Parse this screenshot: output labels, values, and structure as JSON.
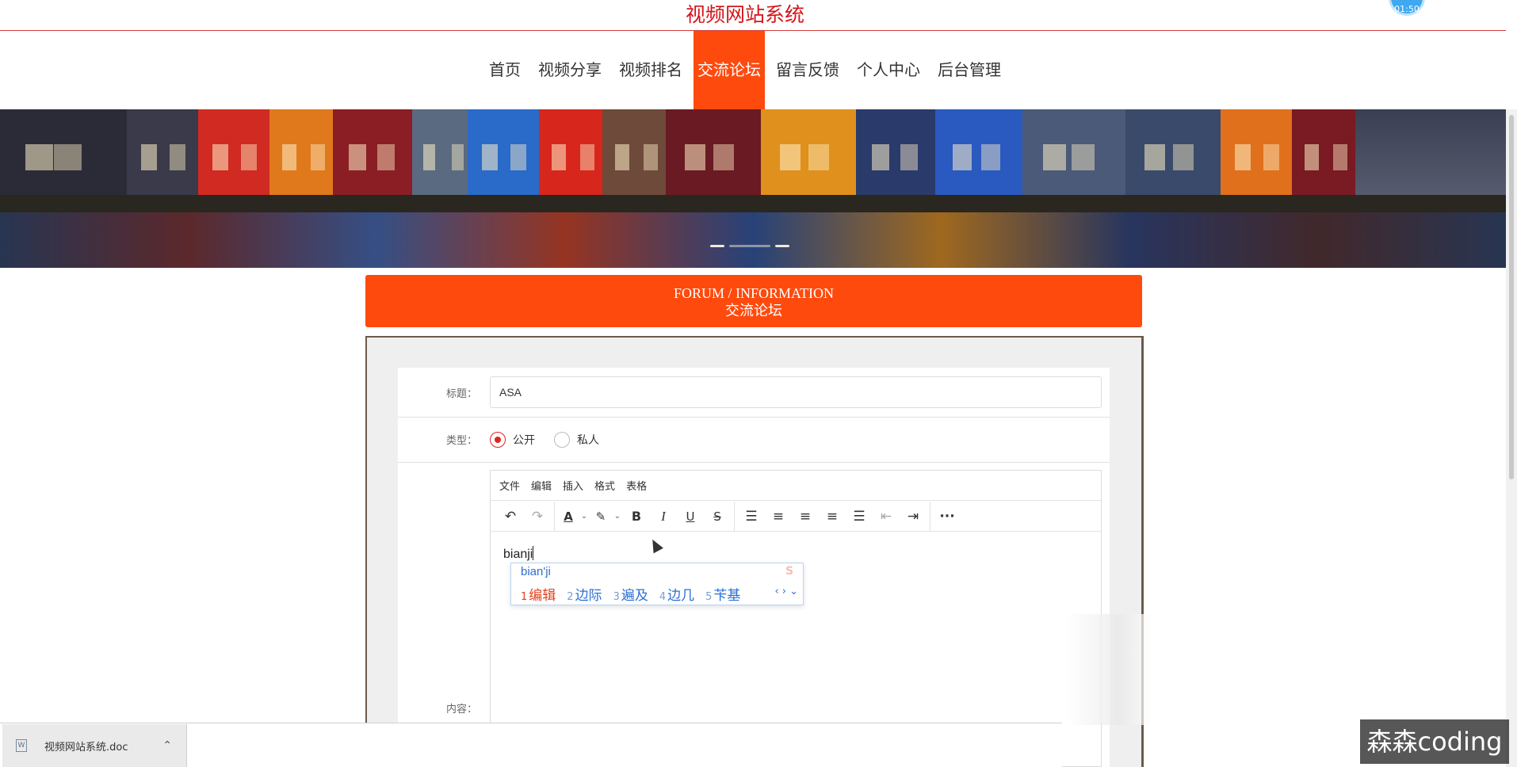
{
  "site": {
    "title": "视频网站系统",
    "clock": "01:50"
  },
  "nav": {
    "items": [
      {
        "label": "首页",
        "active": false
      },
      {
        "label": "视频分享",
        "active": false
      },
      {
        "label": "视频排名",
        "active": false
      },
      {
        "label": "交流论坛",
        "active": true
      },
      {
        "label": "留言反馈",
        "active": false
      },
      {
        "label": "个人中心",
        "active": false
      },
      {
        "label": "后台管理",
        "active": false
      }
    ]
  },
  "banner": {
    "dots": 3,
    "active_dot": 1
  },
  "section": {
    "title_en": "FORUM / INFORMATION",
    "title_cn": "交流论坛"
  },
  "form": {
    "title_label": "标题：",
    "title_value": "ASA",
    "type_label": "类型：",
    "type_options": [
      {
        "label": "公开",
        "checked": true
      },
      {
        "label": "私人",
        "checked": false
      }
    ],
    "content_label": "内容："
  },
  "editor": {
    "menu": [
      "文件",
      "编辑",
      "插入",
      "格式",
      "表格"
    ],
    "toolbar_icons": [
      "undo-icon",
      "redo-icon",
      "text-color-icon",
      "highlight-icon",
      "bold-icon",
      "italic-icon",
      "underline-icon",
      "strikethrough-icon",
      "line-height-icon",
      "align-left-icon",
      "align-center-icon",
      "align-right-icon",
      "align-justify-icon",
      "outdent-icon",
      "indent-icon",
      "more-icon"
    ],
    "content_text": "bianji"
  },
  "ime": {
    "pinyin": "bian'ji",
    "candidates": [
      {
        "num": "1",
        "text": "编辑"
      },
      {
        "num": "2",
        "text": "边际"
      },
      {
        "num": "3",
        "text": "遍及"
      },
      {
        "num": "4",
        "text": "边几"
      },
      {
        "num": "5",
        "text": "苄基"
      }
    ],
    "nav": "‹ › ⌄"
  },
  "downloads": {
    "file_name": "视频网站系统.doc"
  },
  "watermark": {
    "text": "森森coding"
  },
  "colors": {
    "accent": "#ff4a0e",
    "title_red": "#d4141a",
    "radio_red": "#e02424"
  }
}
